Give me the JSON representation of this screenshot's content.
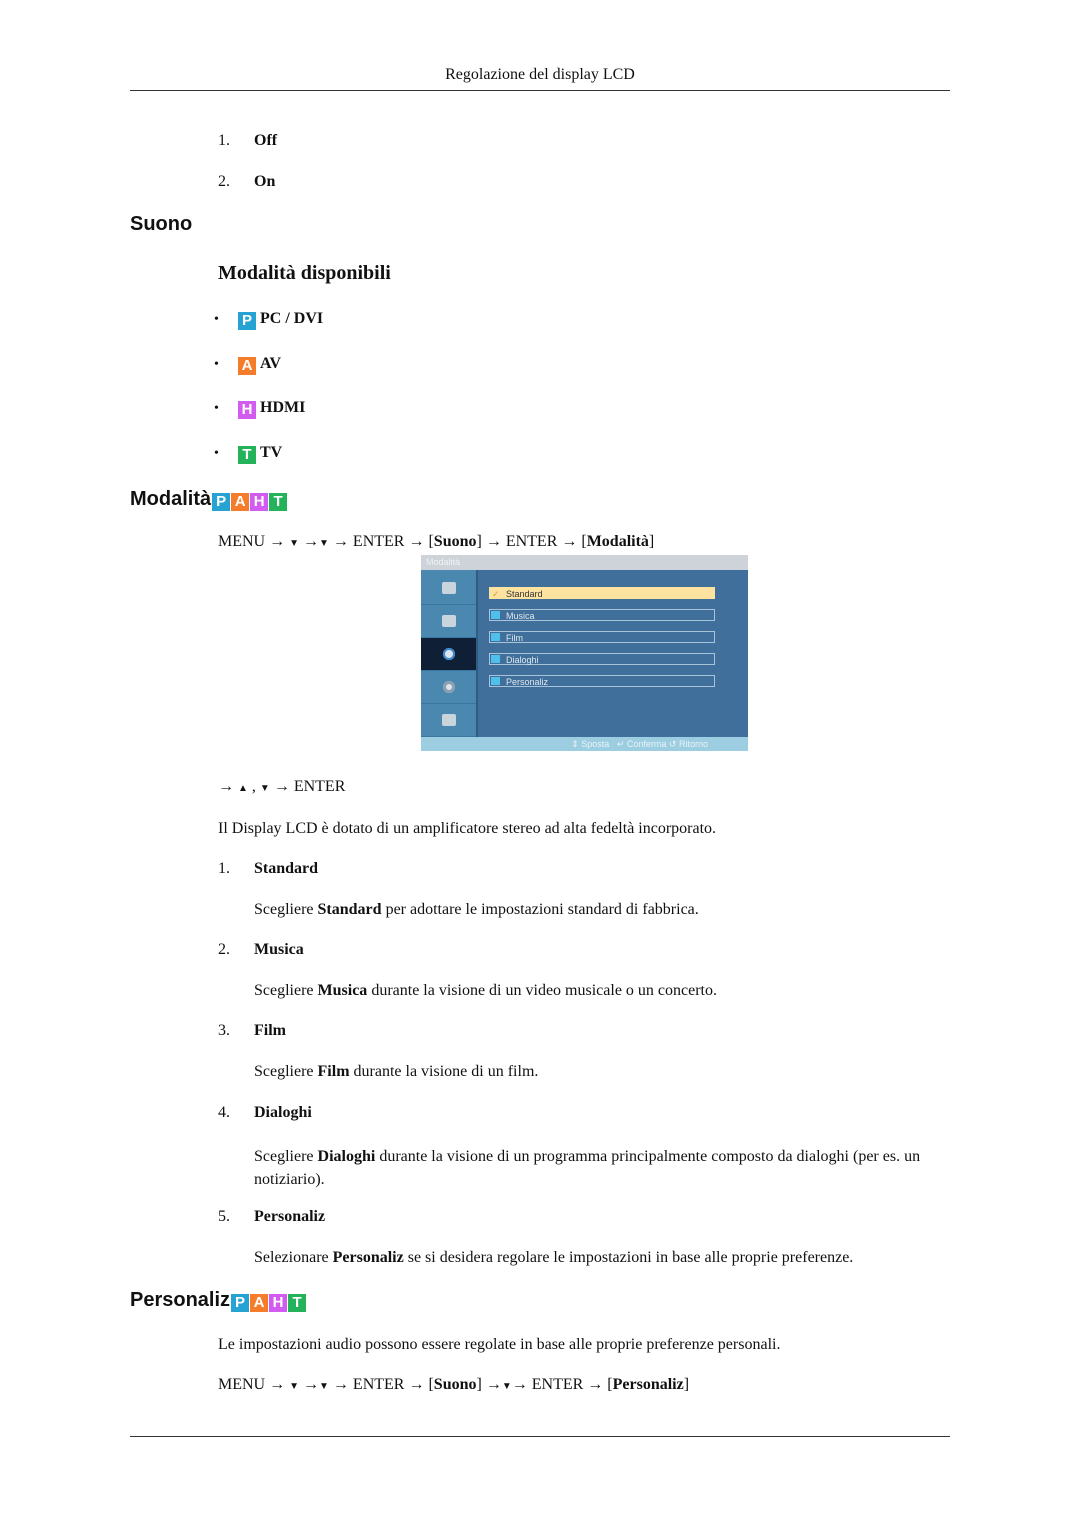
{
  "header": {
    "title": "Regolazione del display LCD"
  },
  "top_list": [
    {
      "num": "1.",
      "label": "Off"
    },
    {
      "num": "2.",
      "label": "On"
    }
  ],
  "suono": {
    "heading": "Suono",
    "subheading": "Modalità disponibili",
    "modes": [
      {
        "badge": "P",
        "color": "#27a3d3",
        "label": "PC / DVI"
      },
      {
        "badge": "A",
        "color": "#f47c2a",
        "label": "AV"
      },
      {
        "badge": "H",
        "color": "#d35cf0",
        "label": "HDMI"
      },
      {
        "badge": "T",
        "color": "#24b35a",
        "label": "TV"
      }
    ]
  },
  "badges": [
    {
      "letter": "P",
      "color": "#27a3d3"
    },
    {
      "letter": "A",
      "color": "#f47c2a"
    },
    {
      "letter": "H",
      "color": "#d35cf0"
    },
    {
      "letter": "T",
      "color": "#24b35a"
    }
  ],
  "modalita": {
    "heading": "Modalità",
    "path": {
      "menu": "MENU",
      "enter": "ENTER",
      "suono": "Suono",
      "target": "Modalità"
    },
    "osd": {
      "title": "Modalità",
      "options": [
        "Standard",
        "Musica",
        "Film",
        "Dialoghi",
        "Personaliz"
      ],
      "selected": "Standard",
      "footer": {
        "move": "Sposta",
        "confirm": "Conferma",
        "back": "Ritorno"
      }
    },
    "nav_hint": {
      "enter": "ENTER"
    },
    "intro": "Il Display LCD è dotato di un amplificatore stereo ad alta fedeltà incorporato.",
    "items": [
      {
        "num": "1.",
        "title": "Standard",
        "pre": "Scegliere ",
        "bold": "Standard",
        "post": " per adottare le impostazioni standard di fabbrica."
      },
      {
        "num": "2.",
        "title": "Musica",
        "pre": "Scegliere ",
        "bold": "Musica",
        "post": " durante la visione di un video musicale o un concerto."
      },
      {
        "num": "3.",
        "title": "Film",
        "pre": "Scegliere ",
        "bold": "Film",
        "post": " durante la visione di un film."
      },
      {
        "num": "4.",
        "title": "Dialoghi",
        "pre": "Scegliere ",
        "bold": "Dialoghi",
        "post": " durante la visione di un programma principalmente composto da dialoghi (per es. un notiziario)."
      },
      {
        "num": "5.",
        "title": "Personaliz",
        "pre": "Selezionare ",
        "bold": "Personaliz",
        "post": " se si desidera regolare le impostazioni in base alle proprie preferenze."
      }
    ]
  },
  "personaliz": {
    "heading": "Personaliz",
    "intro": "Le impostazioni audio possono essere regolate in base alle proprie preferenze personali.",
    "path": {
      "menu": "MENU",
      "enter": "ENTER",
      "suono": "Suono",
      "target": "Personaliz"
    }
  }
}
